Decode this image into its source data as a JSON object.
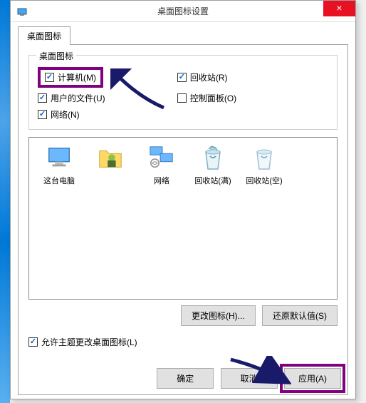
{
  "window": {
    "title": "桌面图标设置",
    "close": "×"
  },
  "tab": {
    "label": "桌面图标"
  },
  "group": {
    "title": "桌面图标",
    "computer": "计算机(M)",
    "recyclebin": "回收站(R)",
    "userfiles": "用户的文件(U)",
    "controlpanel": "控制面板(O)",
    "network": "网络(N)"
  },
  "icons": {
    "thispc": "这台电脑",
    "userfolder": "",
    "network": "网络",
    "binfull": "回收站(满)",
    "binempty": "回收站(空)"
  },
  "buttons": {
    "changeicon": "更改图标(H)...",
    "restore": "还原默认值(S)",
    "ok": "确定",
    "cancel": "取消",
    "apply": "应用(A)"
  },
  "allowthemes": "允许主题更改桌面图标(L)"
}
